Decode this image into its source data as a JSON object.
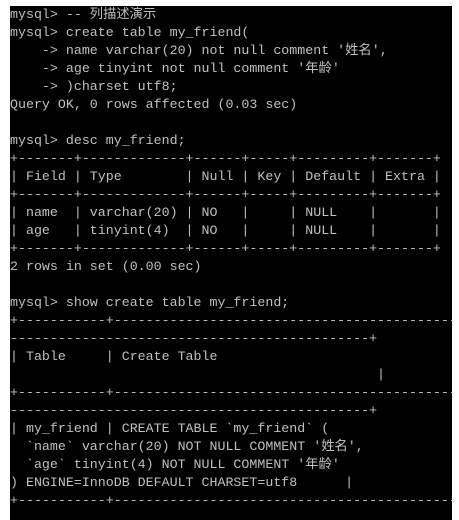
{
  "terminal": {
    "lines": [
      "mysql> -- 列描述演示",
      "mysql> create table my_friend(",
      "    -> name varchar(20) not null comment '姓名',",
      "    -> age tinyint not null comment '年龄'",
      "    -> )charset utf8;",
      "Query OK, 0 rows affected (0.03 sec)",
      "",
      "mysql> desc my_friend;",
      "+-------+-------------+------+-----+---------+-------+",
      "| Field | Type        | Null | Key | Default | Extra |",
      "+-------+-------------+------+-----+---------+-------+",
      "| name  | varchar(20) | NO   |     | NULL    |       |",
      "| age   | tinyint(4)  | NO   |     | NULL    |       |",
      "+-------+-------------+------+-----+---------+-------+",
      "2 rows in set (0.00 sec)",
      "",
      "mysql> show create table my_friend;",
      "+-----------+-------------------------------------------",
      "---------------------------------------------+",
      "| Table     | Create Table",
      "                                              |",
      "+-----------+-------------------------------------------",
      "---------------------------------------------+",
      "| my_friend | CREATE TABLE `my_friend` (",
      "  `name` varchar(20) NOT NULL COMMENT '姓名',",
      "  `age` tinyint(4) NOT NULL COMMENT '年龄'",
      ") ENGINE=InnoDB DEFAULT CHARSET=utf8      |",
      "+-----------+-------------------------------------------"
    ]
  }
}
